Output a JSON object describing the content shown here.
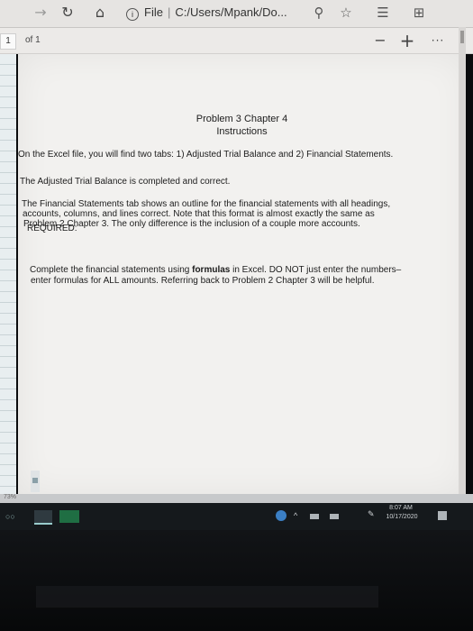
{
  "browser": {
    "address_scheme": "File",
    "address_path": "C:/Users/Mpank/Do...",
    "info_glyph": "i"
  },
  "pdf_toolbar": {
    "page_number": "1",
    "page_of": "of 1",
    "zoom_out": "−",
    "zoom_in": "+",
    "more": "···"
  },
  "document": {
    "title_line1": "Problem 3 Chapter 4",
    "title_line2": "Instructions",
    "para1": "On the Excel file, you will find two tabs: 1) Adjusted Trial Balance and 2) Financial Statements.",
    "para2": "The Adjusted Trial Balance is completed and correct.",
    "para3_line1": "The Financial Statements tab shows an outline for the financial statements with all headings,",
    "para3_line2": "accounts, columns, and lines correct.  Note that this format is almost exactly the same as",
    "para3_line3": "Problem 2 Chapter 3.  The only difference is the inclusion of a couple more accounts.",
    "required": "REQUIRED:",
    "para4_line1_pre": "Complete the financial statements using ",
    "para4_line1_bold": "formulas",
    "para4_line1_post": " in Excel.  DO NOT just enter the numbers–",
    "para4_line2": "enter formulas for ALL amounts.  Referring back to Problem 2 Chapter 3 will be helpful."
  },
  "status": {
    "zoom_label": "73%"
  },
  "taskbar": {
    "time": "8:07 AM",
    "date": "10/17/2020"
  },
  "icons": [
    "back-arrow-icon",
    "refresh-icon",
    "home-icon",
    "info-icon",
    "zoom-icon",
    "favorite-star-icon",
    "favorites-list-icon",
    "collections-icon"
  ]
}
